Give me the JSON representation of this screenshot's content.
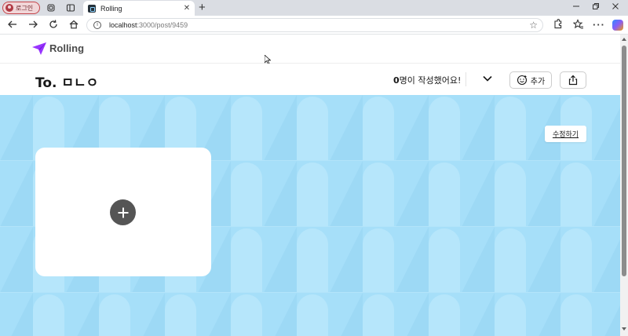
{
  "browser": {
    "profile_label": "로그인",
    "tab_title": "Rolling",
    "tab_close": "✕",
    "new_tab": "+",
    "url_host": "localhost",
    "url_path": ":3000/post/9459"
  },
  "header": {
    "logo_text": "Rolling",
    "brand_color": "#9935ff"
  },
  "subheader": {
    "to_name": "To. ㅁㄴㅇ",
    "writer_count_number": "0",
    "writer_count_suffix": "명이 작성했어요!",
    "add_label": "추가"
  },
  "board": {
    "background_color": "#a6dff9",
    "edit_label": "수정하기"
  },
  "icons": [
    "user-icon",
    "collections-icon",
    "tab-actions-icon",
    "favicon-icon",
    "back-icon",
    "forward-icon",
    "refresh-icon",
    "home-icon",
    "info-icon",
    "star-icon",
    "extensions-icon",
    "favorites-icon",
    "more-icon",
    "copilot-icon",
    "paper-plane-icon",
    "chevron-down-icon",
    "emoji-add-icon",
    "share-icon",
    "plus-icon"
  ]
}
